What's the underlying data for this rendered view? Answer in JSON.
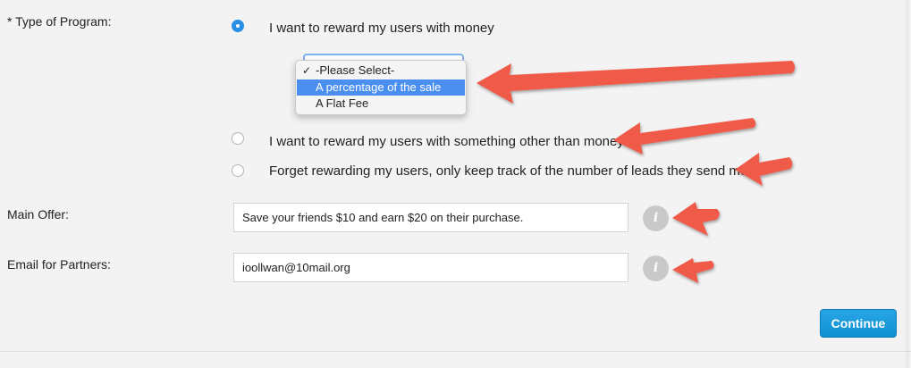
{
  "form": {
    "type_of_program_label": "* Type of Program:",
    "options": [
      {
        "label": "I want to reward my users with money",
        "checked": true
      },
      {
        "label": "I want to reward my users with something other than money",
        "checked": false
      },
      {
        "label": "Forget rewarding my users, only keep track of the number of leads they send me",
        "checked": false
      }
    ],
    "reward_select": {
      "items": [
        "-Please Select-",
        "A percentage of the sale",
        "A Flat Fee"
      ],
      "checked_item": "-Please Select-",
      "highlighted_item": "A percentage of the sale",
      "checkmark": "✓"
    },
    "main_offer": {
      "label": "Main Offer:",
      "value": "Save your friends $10 and earn $20 on their purchase.",
      "info_glyph": "i"
    },
    "email_for_partners": {
      "label": "Email for Partners:",
      "value": "ioollwan@10mail.org",
      "info_glyph": "i"
    },
    "continue_label": "Continue"
  },
  "colors": {
    "accent_blue": "#2a8fe6",
    "annotation_arrow": "#f05a4a",
    "highlight": "#4a8ef0"
  }
}
